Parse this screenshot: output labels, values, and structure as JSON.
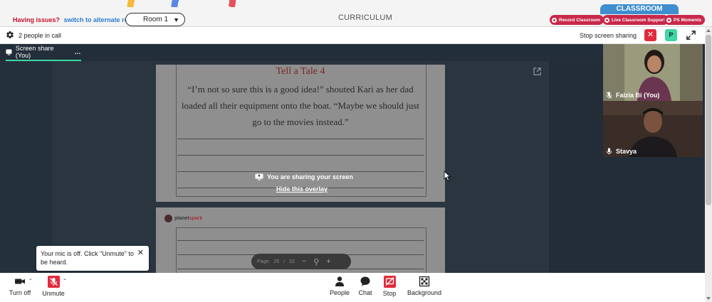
{
  "topbar": {
    "issue_label": "Having issues?",
    "alt_room_link": "switch to alternate room",
    "room_value": "Room 1",
    "section_title": "CURRICULUM",
    "classroom_tab": "CLASSROOM",
    "pills": [
      "Record Classroom",
      "Live Classroom Support",
      "PS Moments"
    ]
  },
  "callbar": {
    "people_count": "2 people in call",
    "stop_sharing_label": "Stop screen sharing",
    "self_initial": "P"
  },
  "stage": {
    "tab_label": "Screen share (You)",
    "tab_more": "…"
  },
  "shared_page": {
    "title": "Tell a Tale 4",
    "story": "“I’m not so sure this is a good idea!” shouted Kari as her dad loaded all their equipment onto the boat. “Maybe we should just go to the movies instead.”",
    "brand_a": "planet",
    "brand_b": "spark",
    "overlay_text": "You are sharing your screen",
    "hide_overlay": "Hide this overlay",
    "pager_label": "Page:",
    "pager_current": "25",
    "pager_sep": "/",
    "pager_total": "32"
  },
  "participants": [
    {
      "name": "Faizia Bi (You)"
    },
    {
      "name": "Stavya"
    }
  ],
  "toast": {
    "message": "Your mic is off. Click \"Unmute\" to be heard.",
    "close": "✕"
  },
  "controls": {
    "camera": "Turn off",
    "mic": "Unmute",
    "people": "People",
    "chat": "Chat",
    "stop": "Stop",
    "background": "Background"
  },
  "colors": {
    "accent_green": "#3fd6a6",
    "danger_red": "#e02b3c",
    "pill_red": "#c8284a",
    "classroom_blue": "#3e8ed0"
  }
}
